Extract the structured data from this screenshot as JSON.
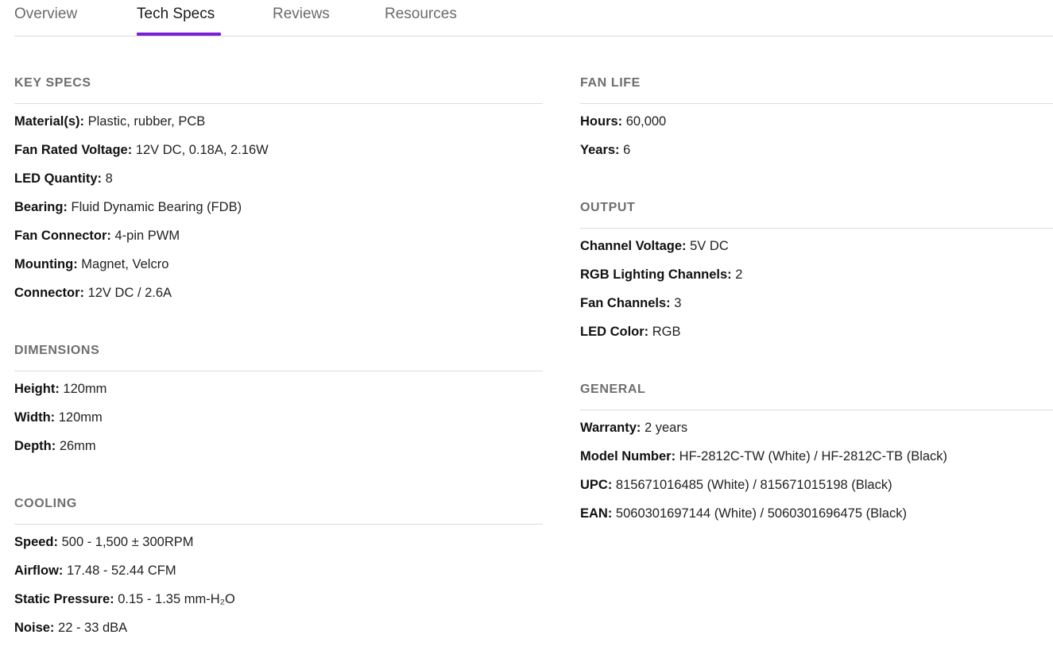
{
  "tabs": [
    {
      "label": "Overview",
      "active": false
    },
    {
      "label": "Tech Specs",
      "active": true
    },
    {
      "label": "Reviews",
      "active": false
    },
    {
      "label": "Resources",
      "active": false
    }
  ],
  "accent_color": "#7a1fd6",
  "left": [
    {
      "title": "KEY SPECS",
      "rows": [
        {
          "key": "Material(s):",
          "value": " Plastic, rubber, PCB"
        },
        {
          "key": "Fan Rated Voltage:",
          "value": " 12V DC, 0.18A, 2.16W"
        },
        {
          "key": "LED Quantity:",
          "value": " 8"
        },
        {
          "key": "Bearing:",
          "value": " Fluid Dynamic Bearing (FDB)"
        },
        {
          "key": "Fan Connector:",
          "value": " 4-pin PWM"
        },
        {
          "key": "Mounting:",
          "value": " Magnet, Velcro"
        },
        {
          "key": "Connector:",
          "value": " 12V DC / 2.6A"
        }
      ]
    },
    {
      "title": "DIMENSIONS",
      "rows": [
        {
          "key": "Height:",
          "value": " 120mm"
        },
        {
          "key": "Width:",
          "value": " 120mm"
        },
        {
          "key": "Depth:",
          "value": " 26mm"
        }
      ]
    },
    {
      "title": "COOLING",
      "rows": [
        {
          "key": "Speed:",
          "value": " 500 - 1,500 ± 300RPM"
        },
        {
          "key": "Airflow:",
          "value": " 17.48 - 52.44 CFM"
        },
        {
          "key": "Static Pressure:",
          "value": " 0.15 - 1.35 mm-H₂O"
        },
        {
          "key": "Noise:",
          "value": " 22 - 33 dBA"
        }
      ]
    }
  ],
  "right": [
    {
      "title": "FAN LIFE",
      "rows": [
        {
          "key": "Hours:",
          "value": " 60,000"
        },
        {
          "key": "Years:",
          "value": " 6"
        }
      ]
    },
    {
      "title": "OUTPUT",
      "rows": [
        {
          "key": "Channel Voltage:",
          "value": " 5V DC"
        },
        {
          "key": "RGB Lighting Channels:",
          "value": " 2"
        },
        {
          "key": "Fan Channels:",
          "value": " 3"
        },
        {
          "key": "LED Color:",
          "value": " RGB"
        }
      ]
    },
    {
      "title": "GENERAL",
      "rows": [
        {
          "key": "Warranty:",
          "value": " 2 years"
        },
        {
          "key": "Model Number:",
          "value": " HF-2812C-TW (White) / HF-2812C-TB (Black)"
        },
        {
          "key": "UPC:",
          "value": " 815671016485 (White) / 815671015198 (Black)"
        },
        {
          "key": "EAN:",
          "value": " 5060301697144 (White) / 5060301696475 (Black)"
        }
      ]
    }
  ]
}
